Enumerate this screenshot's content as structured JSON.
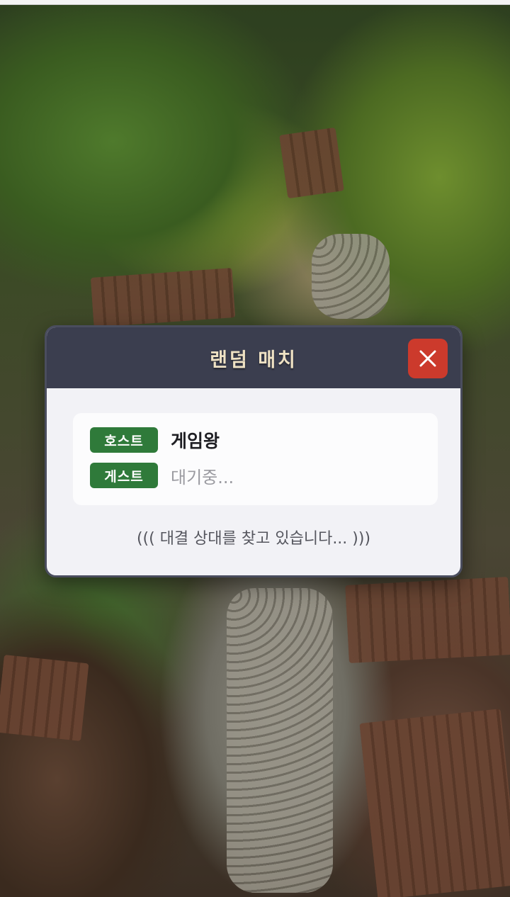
{
  "modal": {
    "title": "랜덤 매치",
    "close_icon": "close-icon",
    "host": {
      "badge": "호스트",
      "name": "게임왕"
    },
    "guest": {
      "badge": "게스트",
      "status": "대기중..."
    },
    "searching_text": "((( 대결 상대를 찾고 있습니다... )))"
  },
  "colors": {
    "header_bg": "#3b3e4f",
    "title_text": "#efe2c4",
    "close_button": "#cc3a2c",
    "badge_green": "#2f7a3a",
    "modal_bg": "#f2f2f6"
  }
}
